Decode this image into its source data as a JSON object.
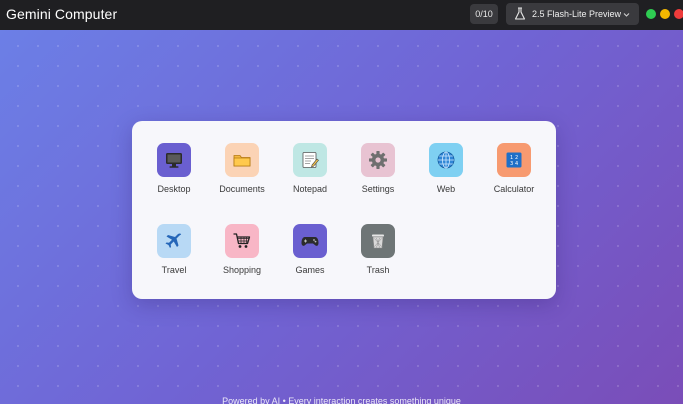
{
  "window": {
    "title": "Gemini Computer",
    "counter": "0/10",
    "model_label": "2.5 Flash-Lite Preview",
    "controls": {
      "green": "#2ecc52",
      "yellow": "#f5b800",
      "red": "#ee3b3b"
    }
  },
  "apps": [
    {
      "id": "desktop",
      "label": "Desktop",
      "icon": "monitor-icon",
      "bg": "#6a5fd0"
    },
    {
      "id": "documents",
      "label": "Documents",
      "icon": "folder-icon",
      "bg": "#fbd3b5"
    },
    {
      "id": "notepad",
      "label": "Notepad",
      "icon": "notepad-icon",
      "bg": "#bfe7e4"
    },
    {
      "id": "settings",
      "label": "Settings",
      "icon": "gear-icon",
      "bg": "#e8c3d2"
    },
    {
      "id": "web",
      "label": "Web",
      "icon": "globe-icon",
      "bg": "#7fd0f2"
    },
    {
      "id": "calculator",
      "label": "Calculator",
      "icon": "calculator-icon",
      "bg": "#f79a70"
    },
    {
      "id": "travel",
      "label": "Travel",
      "icon": "airplane-icon",
      "bg": "#b8d9f5"
    },
    {
      "id": "shopping",
      "label": "Shopping",
      "icon": "shopping-cart-icon",
      "bg": "#f8b6c6"
    },
    {
      "id": "games",
      "label": "Games",
      "icon": "gamepad-icon",
      "bg": "#6a5fd0"
    },
    {
      "id": "trash",
      "label": "Trash",
      "icon": "trash-icon",
      "bg": "#6e7576"
    }
  ],
  "footer": {
    "text": "Powered by AI • Every interaction creates something unique"
  }
}
